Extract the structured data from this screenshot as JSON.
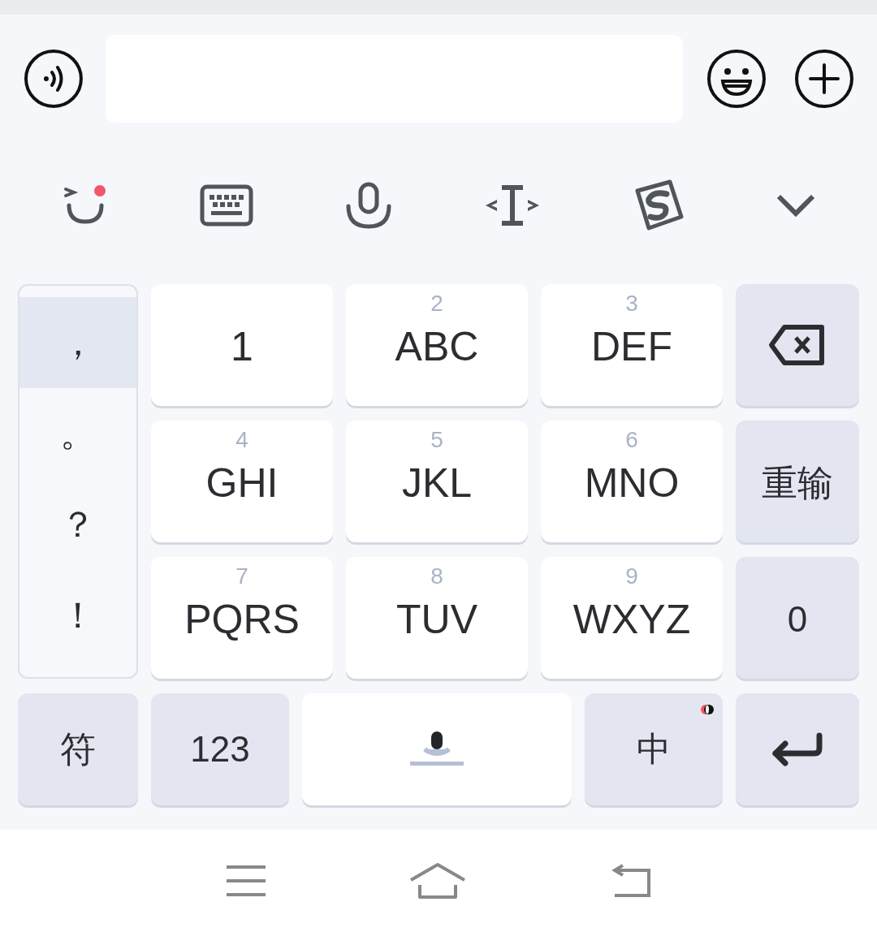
{
  "symbol_list": [
    {
      "label": "，",
      "selected": true
    },
    {
      "label": "。",
      "selected": false
    },
    {
      "label": "？",
      "selected": false
    },
    {
      "label": "！",
      "selected": false
    }
  ],
  "keys": [
    {
      "kind": "letter",
      "label": "1"
    },
    {
      "kind": "letter",
      "digit": "2",
      "label": "ABC"
    },
    {
      "kind": "letter",
      "digit": "3",
      "label": "DEF"
    },
    {
      "kind": "backspace"
    },
    {
      "kind": "letter",
      "digit": "4",
      "label": "GHI"
    },
    {
      "kind": "letter",
      "digit": "5",
      "label": "JKL"
    },
    {
      "kind": "letter",
      "digit": "6",
      "label": "MNO"
    },
    {
      "kind": "function",
      "label": "重输"
    },
    {
      "kind": "letter",
      "digit": "7",
      "label": "PQRS"
    },
    {
      "kind": "letter",
      "digit": "8",
      "label": "TUV"
    },
    {
      "kind": "letter",
      "digit": "9",
      "label": "WXYZ"
    },
    {
      "kind": "function",
      "label": "0"
    }
  ],
  "bottom_row": [
    {
      "kind": "function",
      "label": "符"
    },
    {
      "kind": "function",
      "label": "123"
    },
    {
      "kind": "space"
    },
    {
      "kind": "language",
      "label": "中"
    },
    {
      "kind": "enter"
    }
  ]
}
